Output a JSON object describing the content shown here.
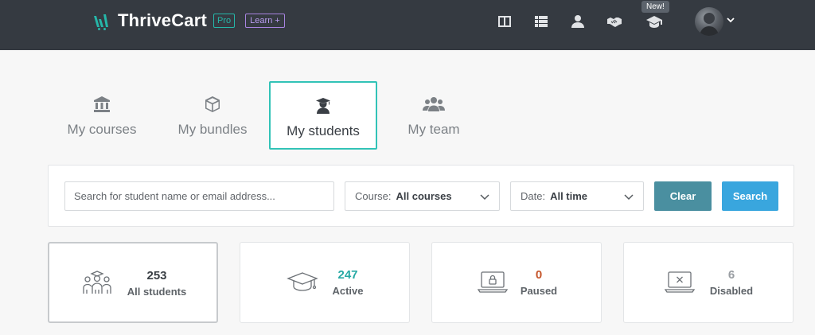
{
  "brand": {
    "name": "ThriveCart",
    "pro_badge": "Pro",
    "learn_badge": "Learn +"
  },
  "topnav": {
    "icons": [
      "columns-icon",
      "list-icon",
      "user-icon",
      "handshake-icon",
      "graduation-cap-icon"
    ],
    "new_badge": "New!"
  },
  "tabs": [
    {
      "label": "My courses",
      "icon": "bank-icon",
      "active": false
    },
    {
      "label": "My bundles",
      "icon": "box-icon",
      "active": false
    },
    {
      "label": "My students",
      "icon": "student-icon",
      "active": true
    },
    {
      "label": "My team",
      "icon": "users-icon",
      "active": false
    }
  ],
  "filters": {
    "search_placeholder": "Search for student name or email address...",
    "course_label": "Course:",
    "course_value": "All courses",
    "date_label": "Date:",
    "date_value": "All time",
    "clear_label": "Clear",
    "search_label": "Search"
  },
  "stats": [
    {
      "value": "253",
      "label": "All students",
      "color": "#3a3f45",
      "icon": "students-group-icon"
    },
    {
      "value": "247",
      "label": "Active",
      "color": "#26a9a4",
      "icon": "graduation-cap-icon"
    },
    {
      "value": "0",
      "label": "Paused",
      "color": "#c5552a",
      "icon": "laptop-lock-icon"
    },
    {
      "value": "6",
      "label": "Disabled",
      "color": "#9a9ea3",
      "icon": "laptop-x-icon"
    }
  ],
  "colors": {
    "topbar": "#353a41",
    "accent": "#32c3b7",
    "clear_button": "#4a8fa0",
    "search_button": "#39a6de"
  }
}
